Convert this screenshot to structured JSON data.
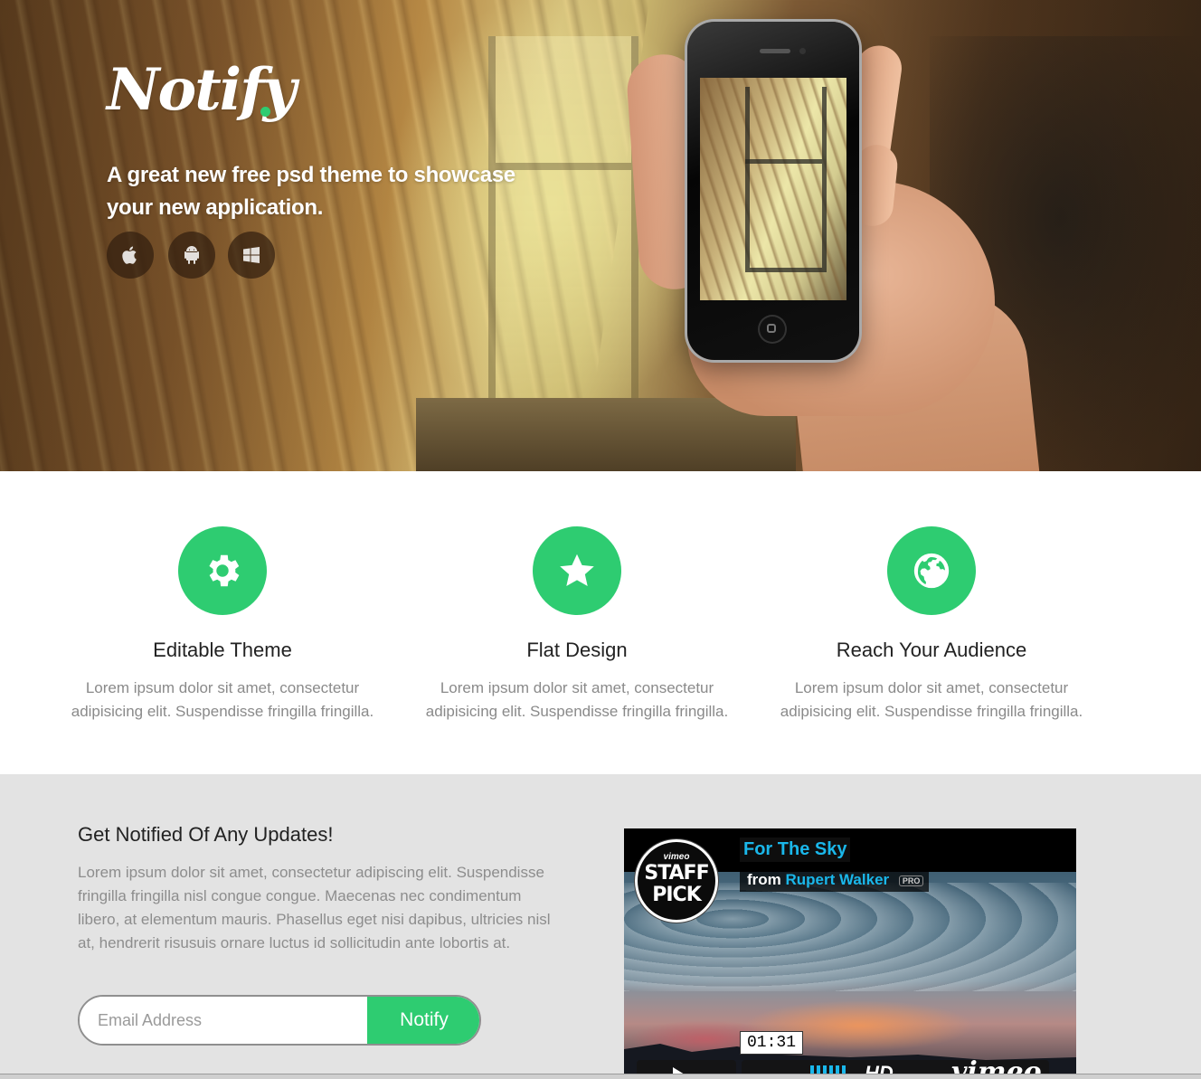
{
  "hero": {
    "logo_text": "Notify",
    "tagline": "A great new free psd theme to showcase your new application.",
    "platforms": [
      {
        "icon": "apple-icon"
      },
      {
        "icon": "android-icon"
      },
      {
        "icon": "windows-icon"
      }
    ]
  },
  "features": [
    {
      "icon": "gear-icon",
      "title": "Editable Theme",
      "text": "Lorem ipsum dolor sit amet, consectetur adipisicing elit. Suspendisse fringilla fringilla."
    },
    {
      "icon": "star-icon",
      "title": "Flat Design",
      "text": "Lorem ipsum dolor sit amet, consectetur adipisicing elit. Suspendisse fringilla fringilla."
    },
    {
      "icon": "globe-icon",
      "title": "Reach Your Audience",
      "text": "Lorem ipsum dolor sit amet, consectetur adipisicing elit. Suspendisse fringilla fringilla."
    }
  ],
  "notify": {
    "heading": "Get Notified Of Any Updates!",
    "body": "Lorem ipsum dolor sit amet, consectetur adipiscing elit. Suspendisse fringilla fringilla nisl congue congue. Maecenas nec condimentum libero, at elementum mauris. Phasellus eget nisi dapibus, ultricies nisl at, hendrerit risusuis ornare luctus id sollicitudin ante lobortis at.",
    "email_placeholder": "Email Address",
    "email_value": "",
    "button_label": "Notify"
  },
  "video": {
    "badge_brand": "vimeo",
    "badge_text": "STAFF PICK",
    "title": "For The Sky",
    "from_label": "from",
    "author": "Rupert Walker",
    "pro_badge": "PRO",
    "timecode": "01:31",
    "hd_label": "HD",
    "brand": "vimeo"
  },
  "colors": {
    "accent": "#2ecc71",
    "vimeo_blue": "#1ab7ea",
    "section_gray": "#e3e3e3"
  }
}
